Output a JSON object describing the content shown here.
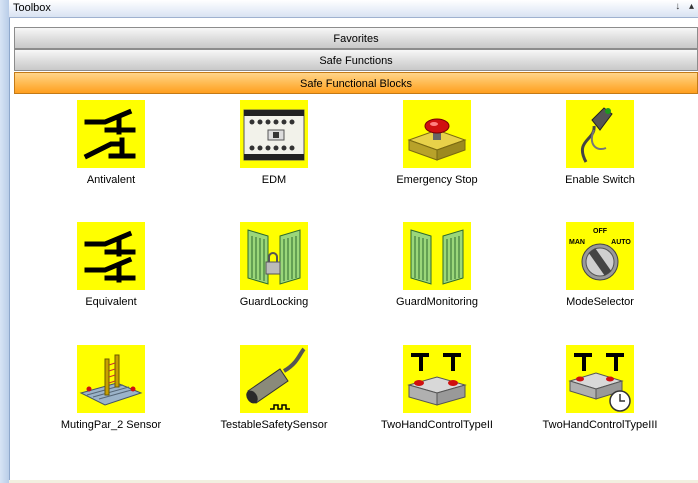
{
  "window": {
    "title": "Toolbox",
    "pin_glyph": "↓",
    "dropdown_glyph": "▴",
    "close_glyph": "×"
  },
  "sections": [
    {
      "label": "Favorites",
      "state": "collapsed"
    },
    {
      "label": "Safe Functions",
      "state": "collapsed"
    },
    {
      "label": "Safe Functional Blocks",
      "state": "expanded"
    }
  ],
  "items": [
    {
      "label": "Antivalent",
      "icon": "antivalent-switch-icon"
    },
    {
      "label": "EDM",
      "icon": "contactor-relay-icon"
    },
    {
      "label": "Emergency Stop",
      "icon": "emergency-stop-button-icon"
    },
    {
      "label": "Enable Switch",
      "icon": "enable-switch-handheld-icon"
    },
    {
      "label": "Equivalent",
      "icon": "equivalent-switch-icon"
    },
    {
      "label": "GuardLocking",
      "icon": "guard-locking-door-icon"
    },
    {
      "label": "GuardMonitoring",
      "icon": "guard-monitoring-door-icon"
    },
    {
      "label": "ModeSelector",
      "icon": "mode-selector-dial-icon",
      "icon_text": {
        "off": "OFF",
        "man": "MAN",
        "auto": "AUTO"
      }
    },
    {
      "label": "MutingPar_2 Sensor",
      "icon": "muting-sensor-conveyor-icon"
    },
    {
      "label": "TestableSafetySensor",
      "icon": "proximity-sensor-icon"
    },
    {
      "label": "TwoHandControlTypeII",
      "icon": "two-hand-control-icon"
    },
    {
      "label": "TwoHandControlTypeIII",
      "icon": "two-hand-control-timer-icon"
    }
  ],
  "colors": {
    "icon_background": "#ffff00",
    "selected_section": "#ffb84d",
    "section_bar": "#dcdcdc"
  }
}
